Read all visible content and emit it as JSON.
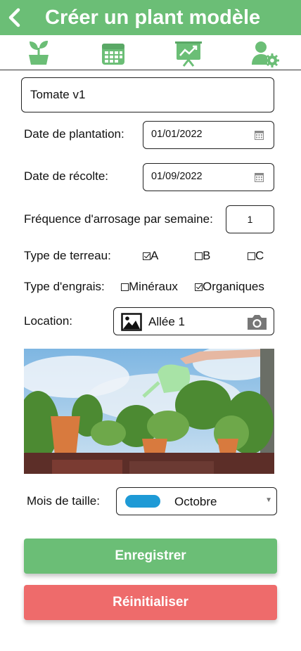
{
  "header": {
    "title": "Créer un plant modèle",
    "color": "#6bbe76"
  },
  "tabs": [
    {
      "icon": "seedling-icon"
    },
    {
      "icon": "calendar-icon"
    },
    {
      "icon": "growth-chart-icon"
    },
    {
      "icon": "user-settings-icon"
    }
  ],
  "form": {
    "name_value": "Tomate v1",
    "planting_date": {
      "label": "Date de plantation:",
      "value": "01/01/2022"
    },
    "harvest_date": {
      "label": "Date de récolte:",
      "value": "01/09/2022"
    },
    "watering": {
      "label": "Fréquence d'arrosage par semaine:",
      "value": "1"
    },
    "soil": {
      "label": "Type de terreau:",
      "options": [
        {
          "label": "A",
          "checked": true
        },
        {
          "label": "B",
          "checked": false
        },
        {
          "label": "C",
          "checked": false
        }
      ]
    },
    "fertilizer": {
      "label": "Type d'engrais:",
      "options": [
        {
          "label": "Minéraux",
          "checked": false
        },
        {
          "label": "Organiques",
          "checked": true
        }
      ]
    },
    "location": {
      "label": "Location:",
      "value": "Allée 1"
    },
    "pruning": {
      "label": "Mois de taille:",
      "value": "Octobre",
      "swatch_color": "#1e9ad6"
    }
  },
  "buttons": {
    "save": {
      "label": "Enregistrer",
      "color": "#6bbe76"
    },
    "reset": {
      "label": "Réinitialiser",
      "color": "#ee6b6b"
    }
  }
}
